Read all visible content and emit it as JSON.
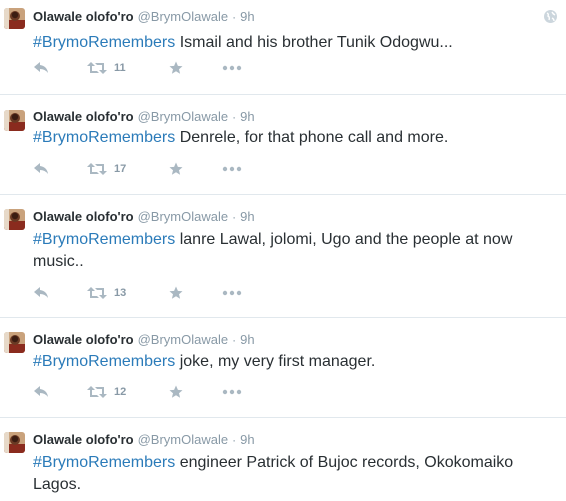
{
  "colors": {
    "hashtag": "#2b7bb9",
    "muted": "#8899a6",
    "text": "#292f33",
    "divider": "#e1e8ed"
  },
  "tweets": [
    {
      "name": "Olawale olofo'ro",
      "handle": "@BrymOlawale",
      "separator": "·",
      "time": "9h",
      "hashtag": "#BrymoRemembers",
      "text": " Ismail and his brother Tunik Odogwu...",
      "retweets": "11",
      "icons": [
        "reply-icon",
        "retweet-icon",
        "favorite-icon",
        "more-icon"
      ]
    },
    {
      "name": "Olawale olofo'ro",
      "handle": "@BrymOlawale",
      "separator": "·",
      "time": "9h",
      "hashtag": "#BrymoRemembers",
      "text": " Denrele, for that phone call and more.",
      "retweets": "17",
      "icons": [
        "reply-icon",
        "retweet-icon",
        "favorite-icon",
        "more-icon"
      ]
    },
    {
      "name": "Olawale olofo'ro",
      "handle": "@BrymOlawale",
      "separator": "·",
      "time": "9h",
      "hashtag": "#BrymoRemembers",
      "text": " lanre Lawal, jolomi, Ugo and the people at now music..",
      "retweets": "13",
      "icons": [
        "reply-icon",
        "retweet-icon",
        "favorite-icon",
        "more-icon"
      ]
    },
    {
      "name": "Olawale olofo'ro",
      "handle": "@BrymOlawale",
      "separator": "·",
      "time": "9h",
      "hashtag": "#BrymoRemembers",
      "text": " joke, my very first manager.",
      "retweets": "12",
      "icons": [
        "reply-icon",
        "retweet-icon",
        "favorite-icon",
        "more-icon"
      ]
    },
    {
      "name": "Olawale olofo'ro",
      "handle": "@BrymOlawale",
      "separator": "·",
      "time": "9h",
      "hashtag": "#BrymoRemembers",
      "text": " engineer Patrick of Bujoc records, Okokomaiko Lagos.",
      "retweets": "",
      "icons": []
    }
  ],
  "header_icon": "globe-icon"
}
